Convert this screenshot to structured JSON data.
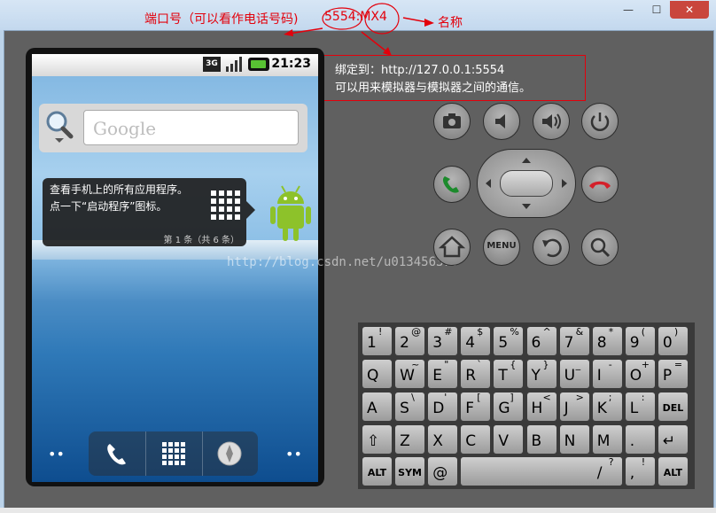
{
  "annotations": {
    "port_label": "端口号（可以看作电话号码)",
    "device_id": "5554:MX4",
    "name_label": "名称",
    "bind_line1": "绑定到：http://127.0.0.1:5554",
    "bind_line2": "可以用来模拟器与模拟器之间的通信。"
  },
  "window": {
    "minimize": "—",
    "maximize": "☐",
    "close": "✕"
  },
  "statusbar": {
    "network": "3G",
    "time": "21:23"
  },
  "home": {
    "search_placeholder": "Google",
    "tip_line1": "查看手机上的所有应用程序。",
    "tip_line2": "点一下“启动程序”图标。",
    "tip_pager": "第 1 条（共 6 条）",
    "left_dots": "••",
    "right_dots": "••"
  },
  "watermark": "http://blog.csdn.net/u013456370",
  "controls": {
    "menu_label": "MENU"
  },
  "keyboard": {
    "row1": [
      {
        "k": "1",
        "s": "!"
      },
      {
        "k": "2",
        "s": "@"
      },
      {
        "k": "3",
        "s": "#"
      },
      {
        "k": "4",
        "s": "$"
      },
      {
        "k": "5",
        "s": "%"
      },
      {
        "k": "6",
        "s": "^"
      },
      {
        "k": "7",
        "s": "&"
      },
      {
        "k": "8",
        "s": "*"
      },
      {
        "k": "9",
        "s": "("
      },
      {
        "k": "0",
        "s": ")"
      }
    ],
    "row2": [
      {
        "k": "Q",
        "s": ""
      },
      {
        "k": "W",
        "s": "~"
      },
      {
        "k": "E",
        "s": "\""
      },
      {
        "k": "R",
        "s": "`"
      },
      {
        "k": "T",
        "s": "{"
      },
      {
        "k": "Y",
        "s": "}"
      },
      {
        "k": "U",
        "s": "_"
      },
      {
        "k": "I",
        "s": "-"
      },
      {
        "k": "O",
        "s": "+"
      },
      {
        "k": "P",
        "s": "="
      }
    ],
    "row3": [
      {
        "k": "A",
        "s": ""
      },
      {
        "k": "S",
        "s": "\\"
      },
      {
        "k": "D",
        "s": "'"
      },
      {
        "k": "F",
        "s": "["
      },
      {
        "k": "G",
        "s": "]"
      },
      {
        "k": "H",
        "s": "<"
      },
      {
        "k": "J",
        "s": ">"
      },
      {
        "k": "K",
        "s": ";"
      },
      {
        "k": "L",
        "s": ":"
      }
    ],
    "del_label": "DEL",
    "row4": [
      {
        "k": "Z",
        "s": ""
      },
      {
        "k": "X",
        "s": ""
      },
      {
        "k": "C",
        "s": ""
      },
      {
        "k": "V",
        "s": ""
      },
      {
        "k": "B",
        "s": ""
      },
      {
        "k": "N",
        "s": ""
      },
      {
        "k": "M",
        "s": ""
      },
      {
        "k": ".",
        "s": ""
      }
    ],
    "alt_label": "ALT",
    "sym_label": "SYM",
    "at_label": "@",
    "slash_key": "/",
    "slash_sub": "?",
    "comma_key": ",",
    "comma_sub": "!",
    "enter_label": "↵"
  },
  "colors": {
    "annotation": "#e3000b",
    "call": "#1c8a2c",
    "hangup": "#d4202a"
  }
}
